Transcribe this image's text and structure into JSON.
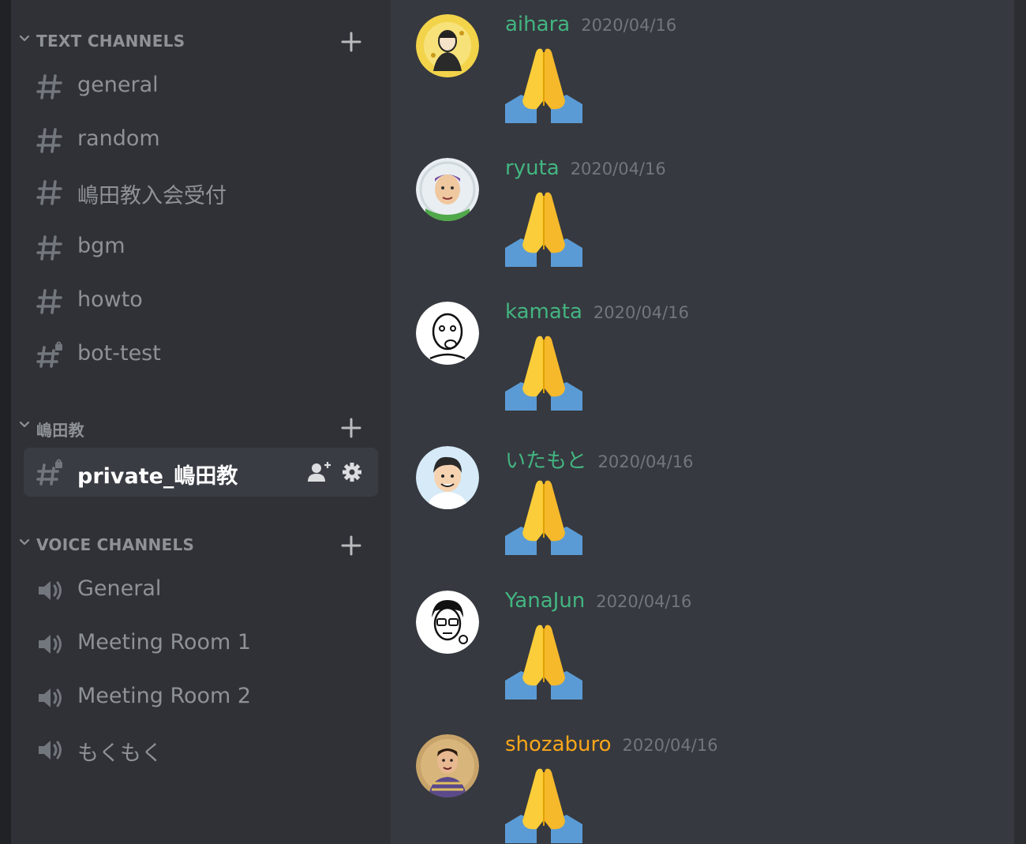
{
  "sidebar": {
    "categories": [
      {
        "label": "TEXT CHANNELS",
        "channels": [
          {
            "label": "general",
            "icon": "hash-icon"
          },
          {
            "label": "random",
            "icon": "hash-icon"
          },
          {
            "label": "嶋田教入会受付",
            "icon": "hash-icon"
          },
          {
            "label": "bgm",
            "icon": "hash-icon"
          },
          {
            "label": "howto",
            "icon": "hash-icon"
          },
          {
            "label": "bot-test",
            "icon": "locked-hash-icon"
          }
        ]
      },
      {
        "label": "嶋田教",
        "channels": [
          {
            "label": "private_嶋田教",
            "icon": "locked-hash-icon",
            "selected": true
          }
        ]
      },
      {
        "label": "VOICE CHANNELS",
        "channels": [
          {
            "label": "General",
            "icon": "speaker-icon"
          },
          {
            "label": "Meeting Room 1",
            "icon": "speaker-icon"
          },
          {
            "label": "Meeting Room 2",
            "icon": "speaker-icon"
          },
          {
            "label": "もくもく",
            "icon": "speaker-icon"
          }
        ]
      }
    ]
  },
  "messages": [
    {
      "username": "aihara",
      "timestamp": "2020/04/16",
      "name_color": "#43b581",
      "reaction": "folded-hands-emoji"
    },
    {
      "username": "ryuta",
      "timestamp": "2020/04/16",
      "name_color": "#43b581",
      "reaction": "folded-hands-emoji"
    },
    {
      "username": "kamata",
      "timestamp": "2020/04/16",
      "name_color": "#43b581",
      "reaction": "folded-hands-emoji"
    },
    {
      "username": "いたもと",
      "timestamp": "2020/04/16",
      "name_color": "#43b581",
      "reaction": "folded-hands-emoji"
    },
    {
      "username": "YanaJun",
      "timestamp": "2020/04/16",
      "name_color": "#43b581",
      "reaction": "folded-hands-emoji"
    },
    {
      "username": "shozaburo",
      "timestamp": "2020/04/16",
      "name_color": "#faa61a",
      "reaction": "folded-hands-emoji"
    }
  ],
  "colors": {
    "sidebar_bg": "#2f3136",
    "chat_bg": "#36393f",
    "muted_text": "#8e9297",
    "selected_bg": "#393c43"
  }
}
